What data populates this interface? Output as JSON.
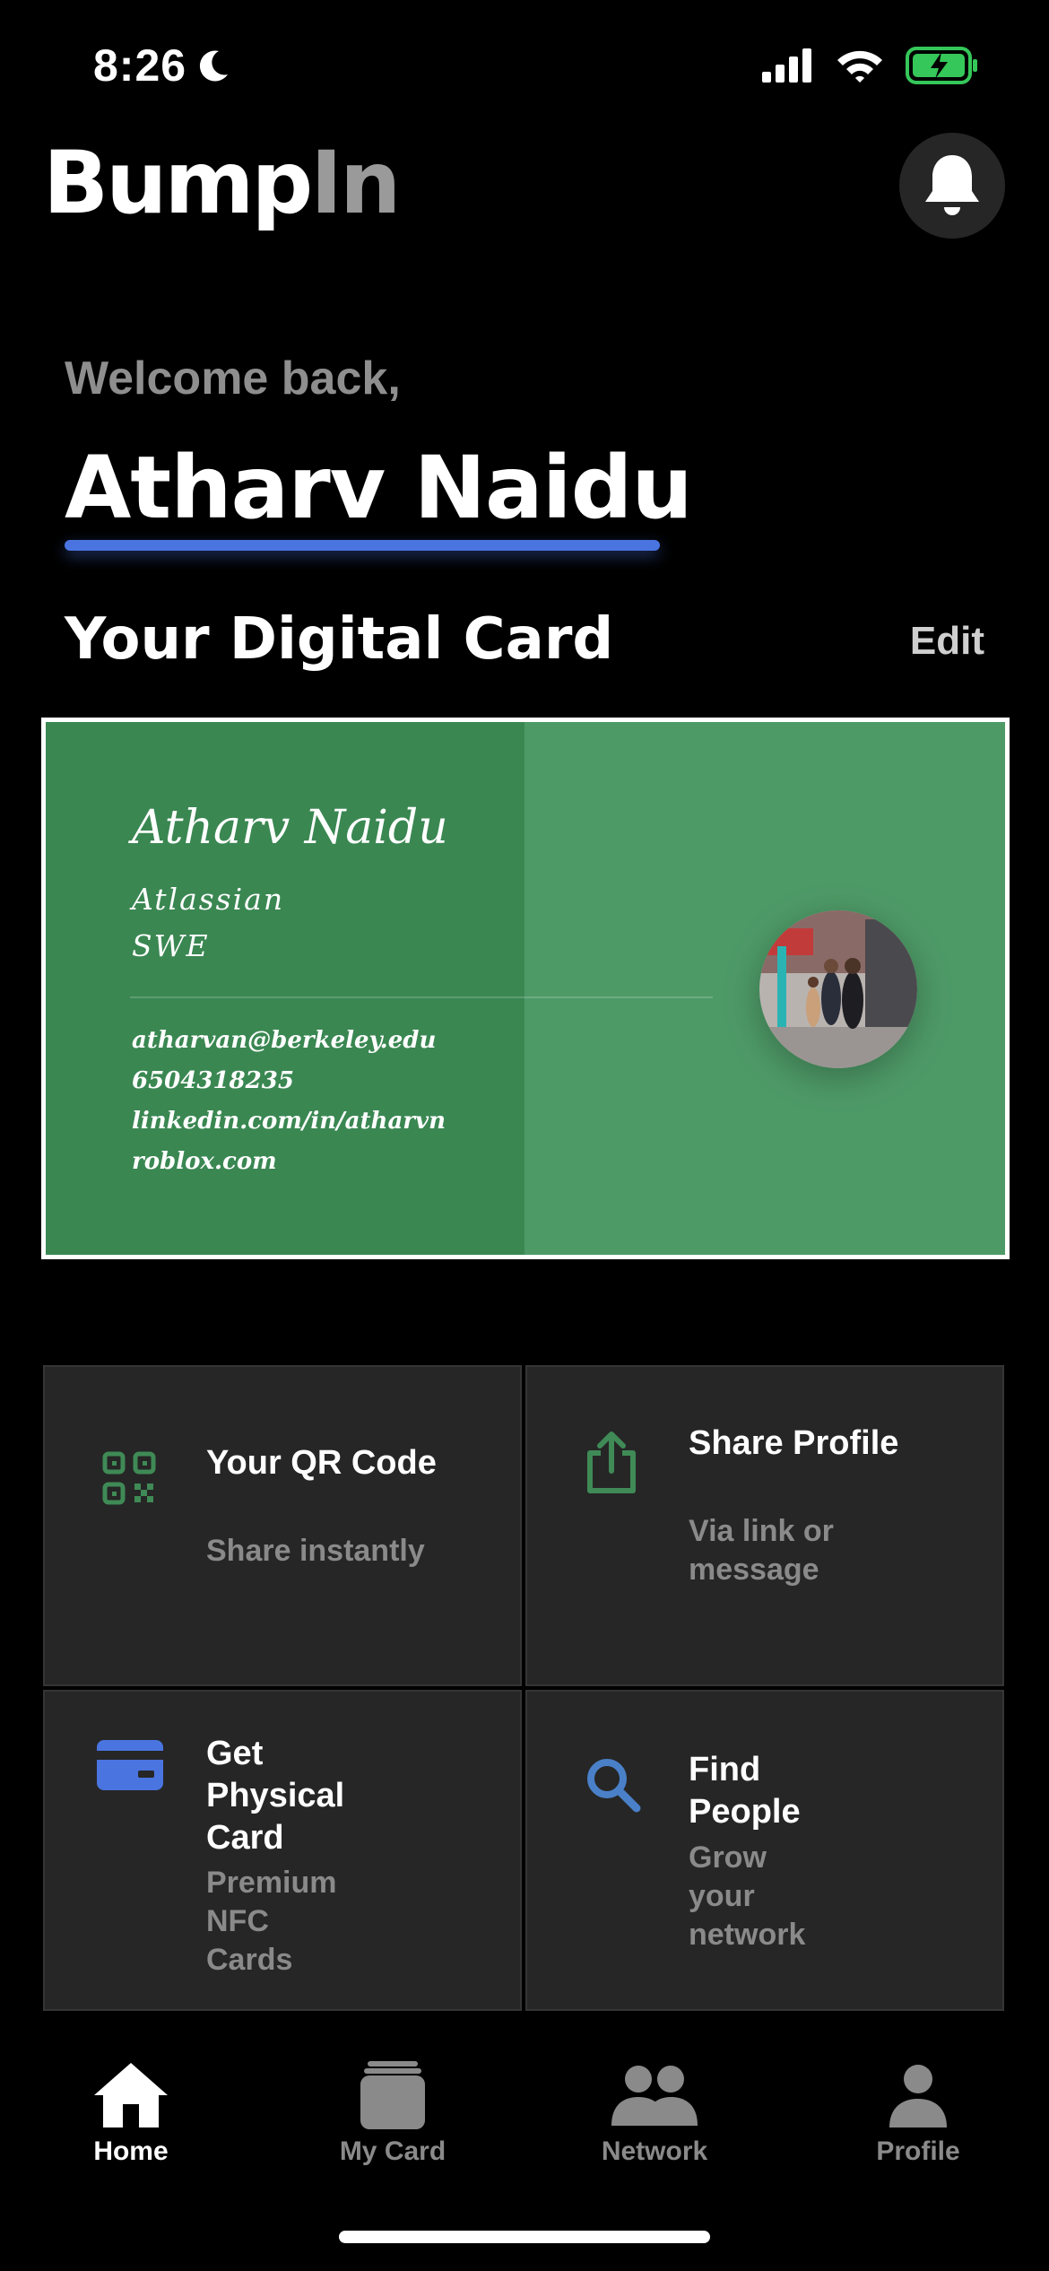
{
  "status_bar": {
    "time": "8:26",
    "focus_icon": "moon-icon",
    "signal_icon": "cellular-signal-icon",
    "wifi_icon": "wifi-icon",
    "battery_icon": "battery-charging-icon",
    "battery_color": "#35c759"
  },
  "header": {
    "logo_part1": "Bump",
    "logo_part2": "In",
    "bell_icon": "bell-icon"
  },
  "welcome": {
    "greeting": "Welcome back,",
    "name": "Atharv Naidu",
    "underline_color": "#4a74e0"
  },
  "digital_card_section": {
    "title": "Your Digital Card",
    "edit_label": "Edit"
  },
  "card": {
    "name": "Atharv Naidu",
    "company": "Atlassian",
    "role": "SWE",
    "contacts": [
      "atharvan@berkeley.edu",
      "6504318235",
      "linkedin.com/in/atharvn",
      "roblox.com"
    ],
    "left_color": "#3a8752",
    "right_color": "#4e9a67"
  },
  "actions": [
    {
      "title": "Your QR Code",
      "subtitle": "Share instantly",
      "icon": "qr-code-icon",
      "icon_color": "#3f8a56"
    },
    {
      "title": "Share Profile",
      "subtitle": "Via link or message",
      "icon": "share-icon",
      "icon_color": "#3f8a56"
    },
    {
      "title": "Get Physical Card",
      "subtitle": "Premium NFC Cards",
      "icon": "credit-card-icon",
      "icon_color": "#4a74e0"
    },
    {
      "title": "Find People",
      "subtitle": "Grow your network",
      "icon": "search-icon",
      "icon_color": "#4a80c8"
    }
  ],
  "nav": {
    "items": [
      {
        "label": "Home",
        "icon": "home-icon",
        "active": true
      },
      {
        "label": "My Card",
        "icon": "card-stack-icon",
        "active": false
      },
      {
        "label": "Network",
        "icon": "people-icon",
        "active": false
      },
      {
        "label": "Profile",
        "icon": "person-icon",
        "active": false
      }
    ],
    "active_color": "#ffffff",
    "inactive_color": "#8a8a8a"
  }
}
